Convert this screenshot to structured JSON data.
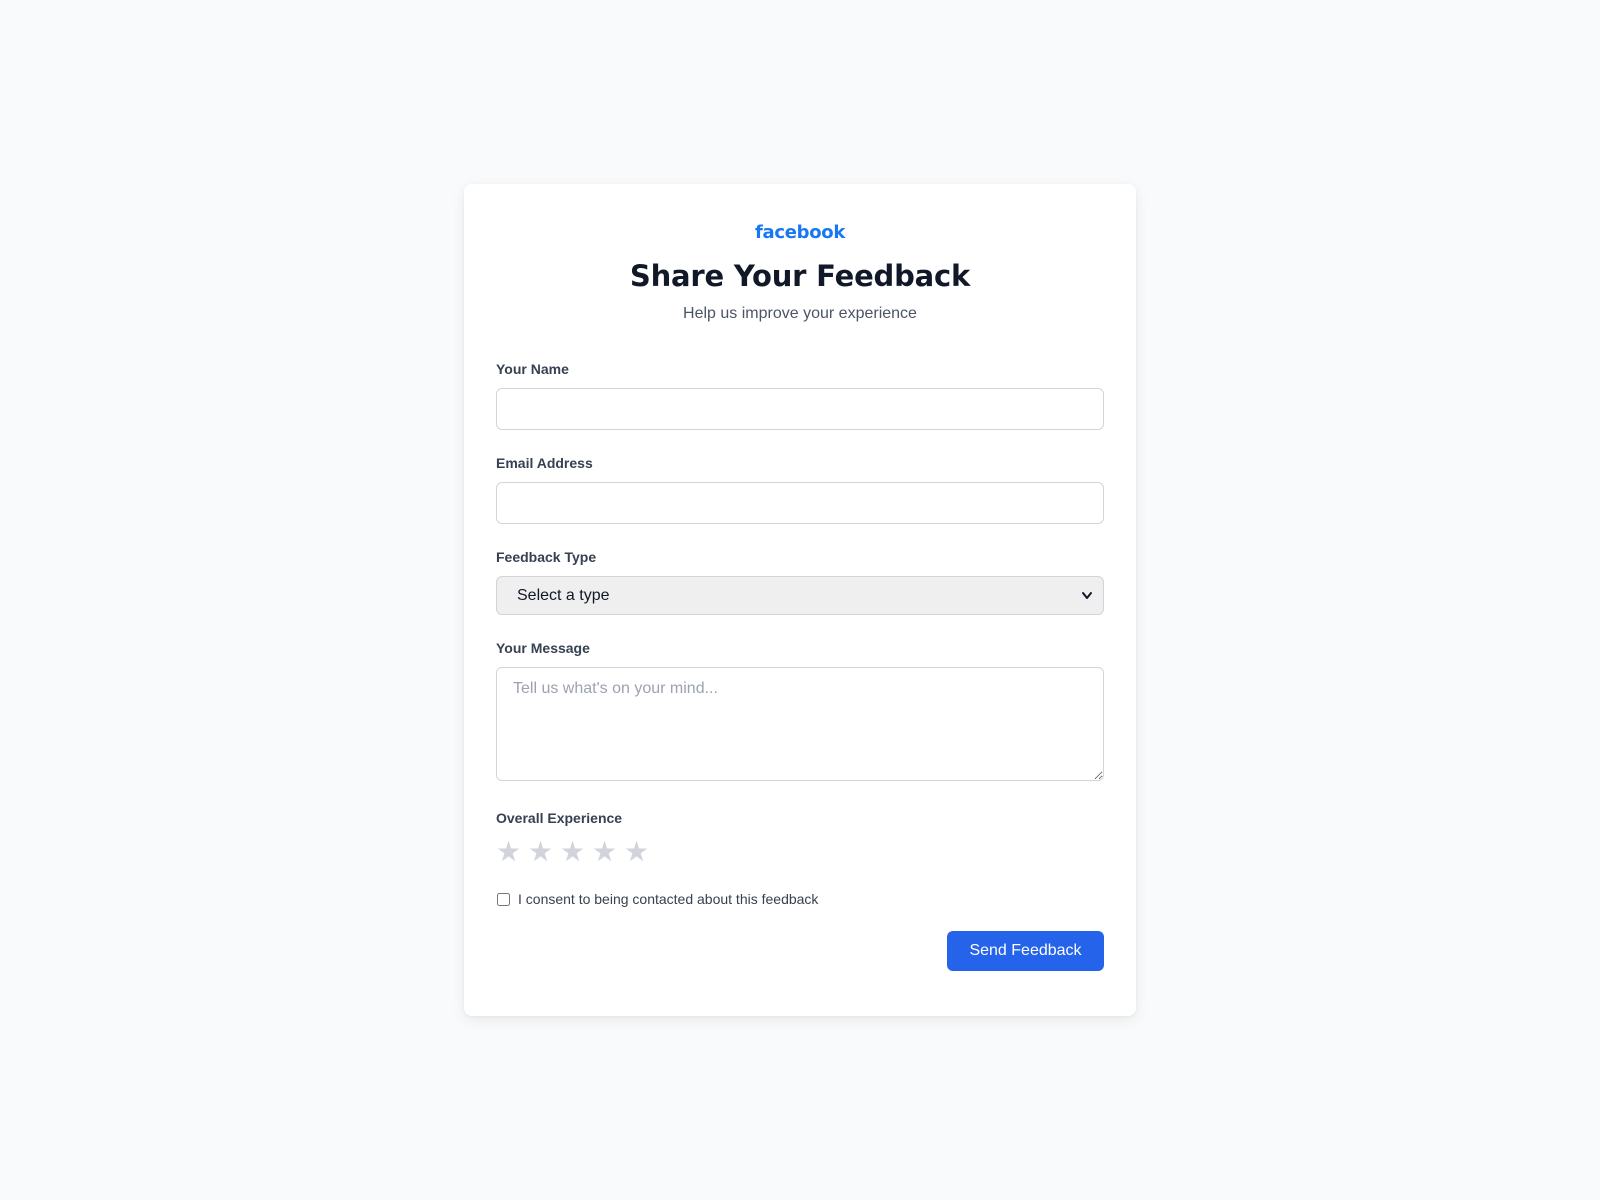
{
  "brand": {
    "logo_text": "facebook",
    "accent_color": "#1877f2"
  },
  "header": {
    "title": "Share Your Feedback",
    "subtitle": "Help us improve your experience"
  },
  "form": {
    "name": {
      "label": "Your Name",
      "value": "",
      "placeholder": ""
    },
    "email": {
      "label": "Email Address",
      "value": "",
      "placeholder": ""
    },
    "feedback_type": {
      "label": "Feedback Type",
      "selected": "Select a type"
    },
    "message": {
      "label": "Your Message",
      "value": "",
      "placeholder": "Tell us what's on your mind..."
    },
    "rating": {
      "label": "Overall Experience",
      "max": 5,
      "value": 0,
      "icon": "star-icon",
      "empty_color": "#d1d5db"
    },
    "consent": {
      "label": "I consent to being contacted about this feedback",
      "checked": false
    },
    "submit": {
      "label": "Send Feedback",
      "color": "#2563eb"
    }
  }
}
